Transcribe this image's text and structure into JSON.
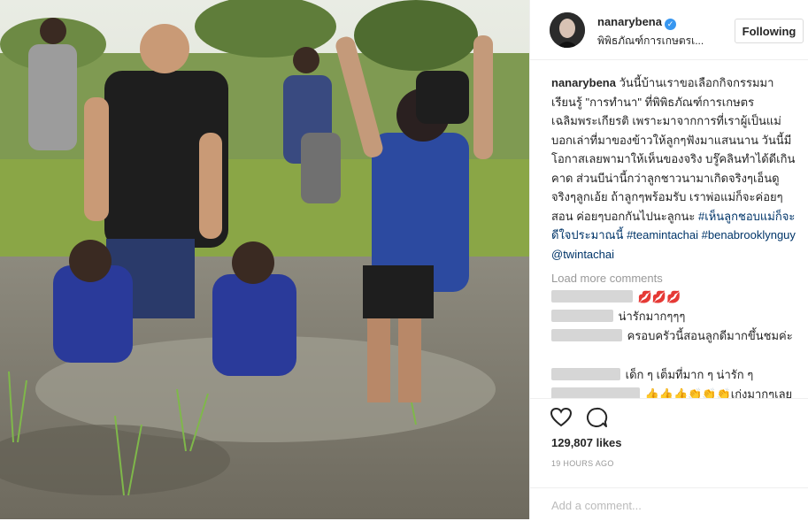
{
  "post": {
    "username": "nanarybena",
    "location": "พิพิธภัณฑ์การเกษตรเ...",
    "follow_label": "Following"
  },
  "caption": {
    "username": "nanarybena",
    "text": "วันนี้บ้านเราขอเลือกกิจกรรมมาเรียนรู้ \"การทำนา\" ที่พิพิธภัณฑ์การเกษตรเฉลิมพระเกียรติ เพราะมาจากการที่เราผู้เป็นแม่บอกเล่าที่มาของข้าวให้ลูกๆฟังมาแสนนาน วันนี้มีโอกาสเลยพามาให้เห็นของจริง บรู๊คลินทำได้ดีเกินคาด ส่วนบีน่านี้กว่าลูกชาวนามาเกิดจริงๆเอ็นดูจริงๆลูกเอ้ย ถ้าลูกๆพร้อมรับ เราพ่อแม่ก็จะค่อยๆสอน ค่อยๆบอกกันไปนะลูกนะ",
    "hashtag1": "#เห็นลูกชอบแม่ก็จะดีใจประมาณนี้",
    "hashtag2": "#teamintachai",
    "hashtag3": "#benabrooklynguy",
    "mention": "@twintachai"
  },
  "load_more": "Load more comments",
  "comments": [
    {
      "text": "💋💋💋"
    },
    {
      "text": "น่ารักมากๆๆๆ"
    },
    {
      "text": "ครอบครัวนี้สอนลูกดีมากขึ้นชมค่ะ"
    },
    {
      "text": "เด็ก ๆ เต็มที่มาก ๆ น่ารัก ๆ"
    },
    {
      "text": "👍👍👍👏👏👏เก่งมากๆเลย"
    }
  ],
  "likes": "129,807 likes",
  "timestamp": "19 HOURS AGO",
  "add_comment_placeholder": "Add a comment...",
  "colors": {
    "link": "#003569",
    "verified": "#3897f0",
    "muted": "#999999"
  },
  "icons": [
    "heart-icon",
    "comment-icon",
    "verified-badge-icon"
  ]
}
